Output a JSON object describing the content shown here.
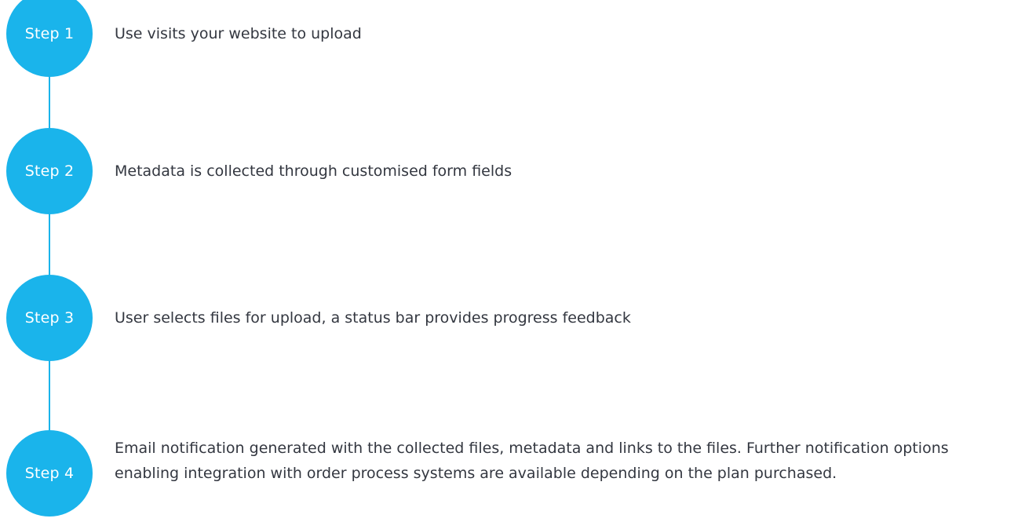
{
  "theme": {
    "accent": "#1ab4eb",
    "text": "#333740"
  },
  "steps": [
    {
      "label": "Step 1",
      "description": "Use visits your website to upload"
    },
    {
      "label": "Step 2",
      "description": "Metadata is collected through customised form fields"
    },
    {
      "label": "Step 3",
      "description": "User selects files for upload, a status bar provides progress feedback"
    },
    {
      "label": "Step 4",
      "description": "Email notification generated with the collected files, metadata and links to the files. Further notification options enabling integration with order process systems are available depending on the plan purchased."
    }
  ]
}
